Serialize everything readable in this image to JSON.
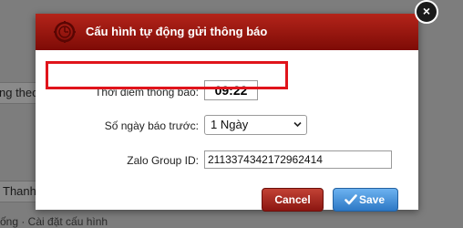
{
  "background": {
    "fragment_1": "ng theo",
    "fragment_2": "Thanh",
    "fragment_3": "ống · Cài đặt cấu hình"
  },
  "modal": {
    "title": "Cấu hình tự động gửi thông báo",
    "close_label": "×",
    "fields": {
      "time_label": "Thời điểm thông báo:",
      "time_value": "09:22",
      "days_label": "Số ngày báo trước:",
      "days_selected": "1 Ngày",
      "zalo_label": "Zalo Group ID:",
      "zalo_value": "2113374342172962414"
    },
    "buttons": {
      "cancel": "Cancel",
      "save": "Save"
    }
  },
  "colors": {
    "title_bar": "#9c1710",
    "highlight": "#e0141b",
    "cancel_button": "#a52a20",
    "save_button": "#4a94dc"
  },
  "icons": {
    "title": "gear-clock-icon",
    "close": "close-icon",
    "select": "chevron-down-icon",
    "save": "check-icon"
  }
}
